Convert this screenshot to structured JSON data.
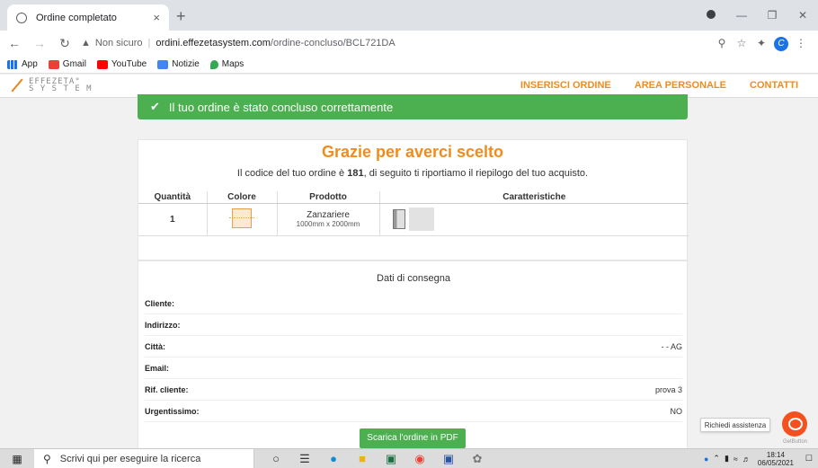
{
  "browser": {
    "tab_title": "Ordine completato",
    "tab_close": "×",
    "new_tab": "+",
    "not_secure": "Non sicuro",
    "url_host": "ordini.effezetasystem.com",
    "url_path": "/ordine-concluso/BCL721DA",
    "avatar_letter": "C",
    "bookmarks": [
      "App",
      "Gmail",
      "YouTube",
      "Notizie",
      "Maps"
    ]
  },
  "site": {
    "logo_line1": "EFFEZETA°",
    "logo_line2": "S Y S T E M",
    "nav": [
      "INSERISCI ORDINE",
      "AREA PERSONALE",
      "CONTATTI"
    ]
  },
  "alert": {
    "message": "Il tuo ordine è stato concluso correttamente"
  },
  "summary": {
    "heading": "Grazie per averci scelto",
    "line_prefix": "Il codice del tuo ordine è ",
    "order_code": "181",
    "line_suffix": ", di seguito ti riportiamo il riepilogo del tuo acquisto.",
    "columns": [
      "Quantità",
      "Colore",
      "Prodotto",
      "Caratteristiche"
    ],
    "row": {
      "quantity": "1",
      "product": "Zanzariere",
      "dimensions": "1000mm x 2000mm"
    }
  },
  "delivery": {
    "heading": "Dati di consegna",
    "rows": [
      {
        "label": "Cliente:",
        "value": ""
      },
      {
        "label": "Indirizzo:",
        "value": ""
      },
      {
        "label": "Città:",
        "value": "- - AG"
      },
      {
        "label": "Email:",
        "value": ""
      },
      {
        "label": "Rif. cliente:",
        "value": "prova 3"
      },
      {
        "label": "Urgentissimo:",
        "value": "NO"
      }
    ],
    "pdf_button": "Scarica l'ordine in PDF"
  },
  "help": {
    "bubble": "Richiedi assistenza",
    "brand": "GetButton"
  },
  "taskbar": {
    "search_placeholder": "Scrivi qui per eseguire la ricerca",
    "time": "18:14",
    "date": "06/05/2021"
  },
  "colors": {
    "accent": "#f08c1d",
    "success": "#4caf50",
    "help": "#f4511e"
  }
}
